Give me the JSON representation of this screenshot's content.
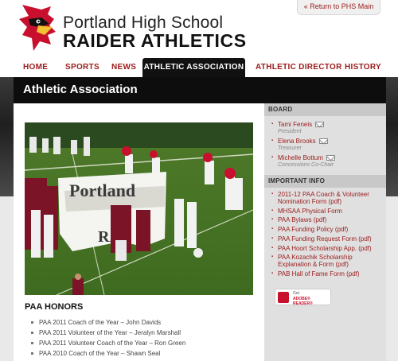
{
  "header": {
    "school_name": "Portland High School",
    "title": "RAIDER ATHLETICS",
    "return_link": "« Return to PHS Main"
  },
  "nav": {
    "items": [
      "HOME",
      "SPORTS",
      "NEWS",
      "ATHLETIC ASSOCIATION",
      "ATHLETIC DIRECTOR",
      "HISTORY"
    ],
    "active": "ATHLETIC ASSOCIATION"
  },
  "page": {
    "title": "Athletic Association"
  },
  "photo": {
    "banner_text_top": "Portland",
    "banner_text_bottom": "RA"
  },
  "honors": {
    "title": "PAA HONORS",
    "items": [
      "PAA 2011 Coach of the Year – John Davids",
      "PAA 2011 Volunteer of the Year – Jeralyn Marshall",
      "PAA 2011 Volunteer Coach of the Year – Ron Green",
      "PAA 2010 Coach of the Year – Shawn Seal"
    ]
  },
  "sidebar": {
    "board_title": "BOARD",
    "board": [
      {
        "name": "Tami Feneis",
        "role": "President"
      },
      {
        "name": "Elena Brooks",
        "role": "Treasurer"
      },
      {
        "name": "Michelle Bottum",
        "role": "Concessions Co-Chair"
      }
    ],
    "info_title": "IMPORTANT INFO",
    "info": [
      "2011-12 PAA Coach & Volunteer Nomination Form (pdf)",
      "MHSAA Physical Form",
      "PAA Bylaws (pdf)",
      "PAA Funding Policy (pdf)",
      "PAA Funding Request Form (pdf)",
      "PAA Hoort Scholarship App. (pdf)",
      "PAA Kozachik Scholarship Explanation & Form (pdf)",
      "PAB Hall of Fame Form (pdf)"
    ],
    "reader_get": "Get",
    "reader_label": "ADOBE® READER®"
  },
  "colors": {
    "accent": "#9b1b1b",
    "nav_active_bg": "#111111"
  }
}
